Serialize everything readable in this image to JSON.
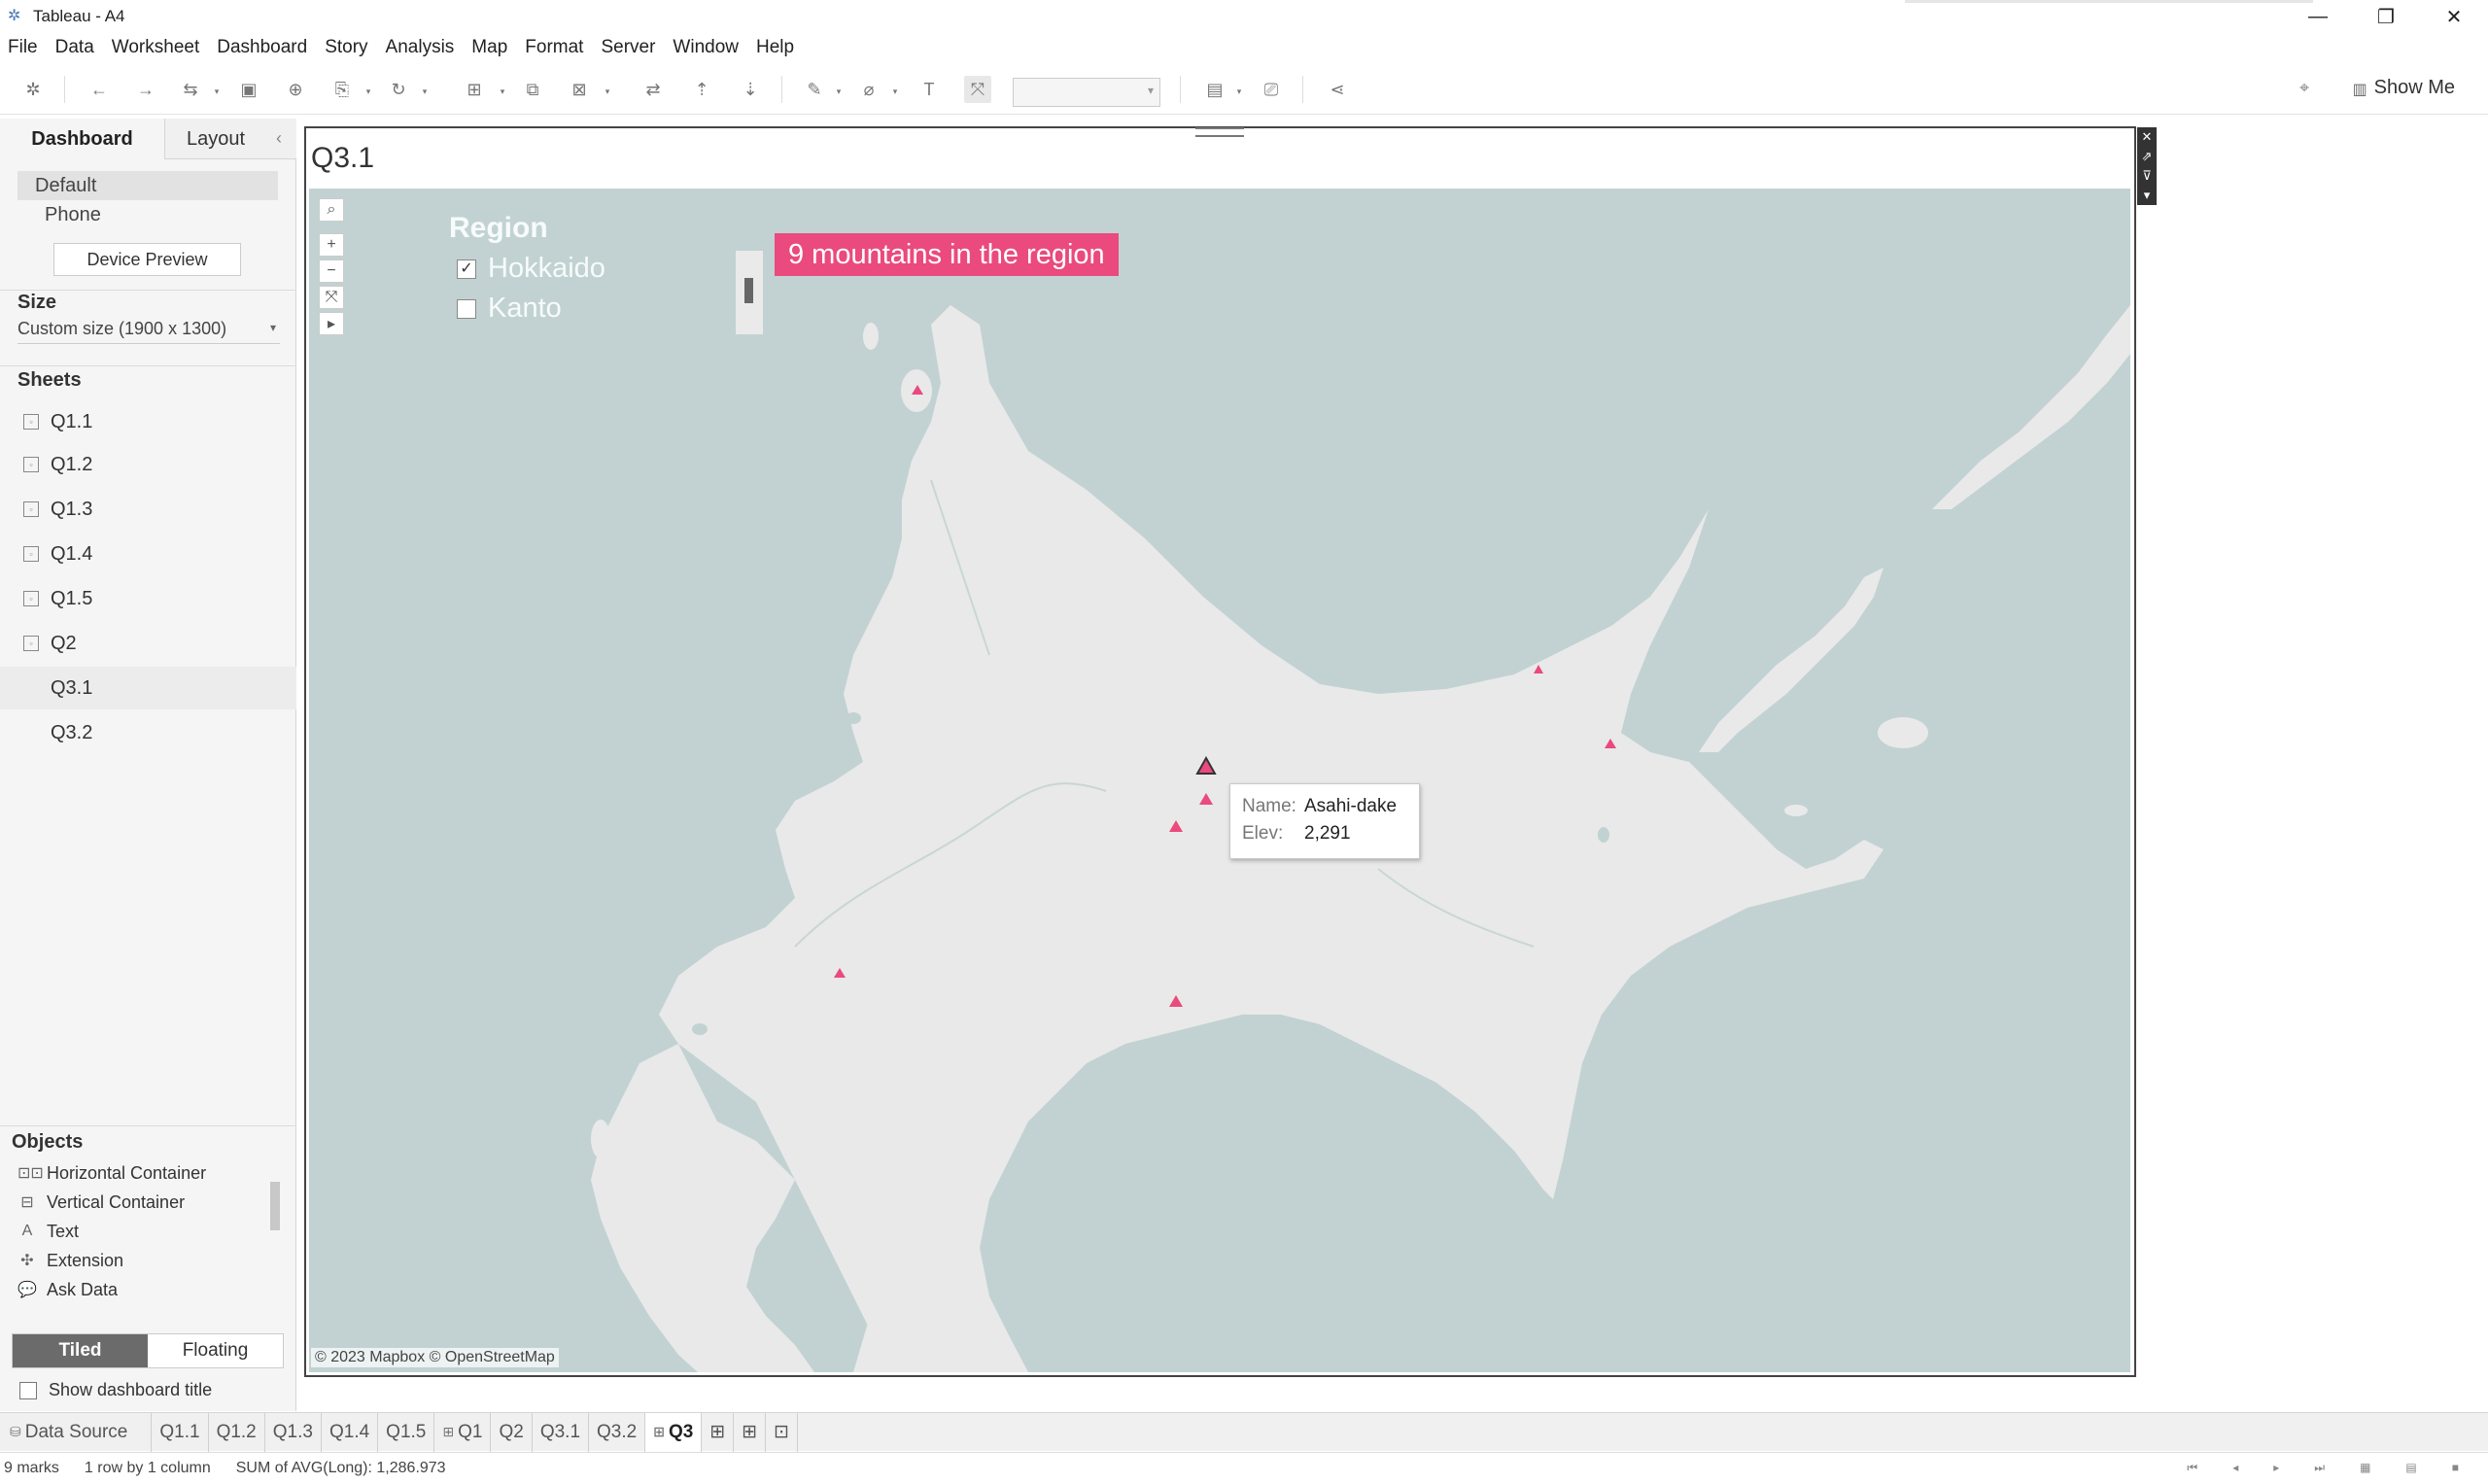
{
  "window": {
    "title": "Tableau - A4",
    "controls": [
      "—",
      "❐",
      "✕"
    ]
  },
  "menu": [
    "File",
    "Data",
    "Worksheet",
    "Dashboard",
    "Story",
    "Analysis",
    "Map",
    "Format",
    "Server",
    "Window",
    "Help"
  ],
  "toolbar": {
    "show_me_label": "Show Me"
  },
  "left_panel": {
    "tabs": {
      "dashboard": "Dashboard",
      "layout": "Layout"
    },
    "device": {
      "default": "Default",
      "phone": "Phone",
      "preview_button": "Device Preview"
    },
    "size": {
      "heading": "Size",
      "value": "Custom size (1900 x 1300)"
    },
    "sheets": {
      "heading": "Sheets",
      "items": [
        {
          "label": "Q1.1",
          "icon": "sheet-icon"
        },
        {
          "label": "Q1.2",
          "icon": "sheet-icon"
        },
        {
          "label": "Q1.3",
          "icon": "sheet-icon"
        },
        {
          "label": "Q1.4",
          "icon": "sheet-icon"
        },
        {
          "label": "Q1.5",
          "icon": "sheet-icon"
        },
        {
          "label": "Q2",
          "icon": "sheet-icon"
        },
        {
          "label": "Q3.1",
          "icon": "map-sheet-icon"
        },
        {
          "label": "Q3.2",
          "icon": "map-sheet-icon"
        }
      ]
    },
    "objects": {
      "heading": "Objects",
      "items": [
        {
          "label": "Horizontal Container",
          "icon": "horizontal-container-icon",
          "glyph": "⊡⊡"
        },
        {
          "label": "Vertical Container",
          "icon": "vertical-container-icon",
          "glyph": "⊟"
        },
        {
          "label": "Text",
          "icon": "text-icon",
          "glyph": "A"
        },
        {
          "label": "Extension",
          "icon": "extension-icon",
          "glyph": "✣"
        },
        {
          "label": "Ask Data",
          "icon": "ask-data-icon",
          "glyph": "💬"
        }
      ]
    },
    "placement": {
      "tiled": "Tiled",
      "floating": "Floating"
    },
    "show_dashboard_title": "Show dashboard title"
  },
  "dashboard": {
    "title": "Q3.1",
    "legend": {
      "title": "Region",
      "items": [
        {
          "label": "Hokkaido",
          "checked": true
        },
        {
          "label": "Kanto",
          "checked": false
        }
      ]
    },
    "banner": "9 mountains in the region",
    "tooltip": {
      "name_key": "Name:",
      "name_value": "Asahi-dake",
      "elev_key": "Elev:",
      "elev_value": "2,291"
    },
    "attribution": "© 2023 Mapbox © OpenStreetMap",
    "colors": {
      "mark": "#ea4a7d",
      "water": "#c2d2d2",
      "land": "#e8e8e8",
      "banner": "#ea4a7d"
    }
  },
  "sheet_tabs": {
    "data_source": "Data Source",
    "tabs": [
      {
        "label": "Q1.1",
        "icon": ""
      },
      {
        "label": "Q1.2",
        "icon": ""
      },
      {
        "label": "Q1.3",
        "icon": ""
      },
      {
        "label": "Q1.4",
        "icon": ""
      },
      {
        "label": "Q1.5",
        "icon": ""
      },
      {
        "label": "Q1",
        "icon": "⊞"
      },
      {
        "label": "Q2",
        "icon": ""
      },
      {
        "label": "Q3.1",
        "icon": ""
      },
      {
        "label": "Q3.2",
        "icon": ""
      },
      {
        "label": "Q3",
        "icon": "⊞",
        "selected": true
      }
    ]
  },
  "status": {
    "marks": "9 marks",
    "dimensions": "1 row by 1 column",
    "sum": "SUM of AVG(Long): 1,286.973"
  }
}
